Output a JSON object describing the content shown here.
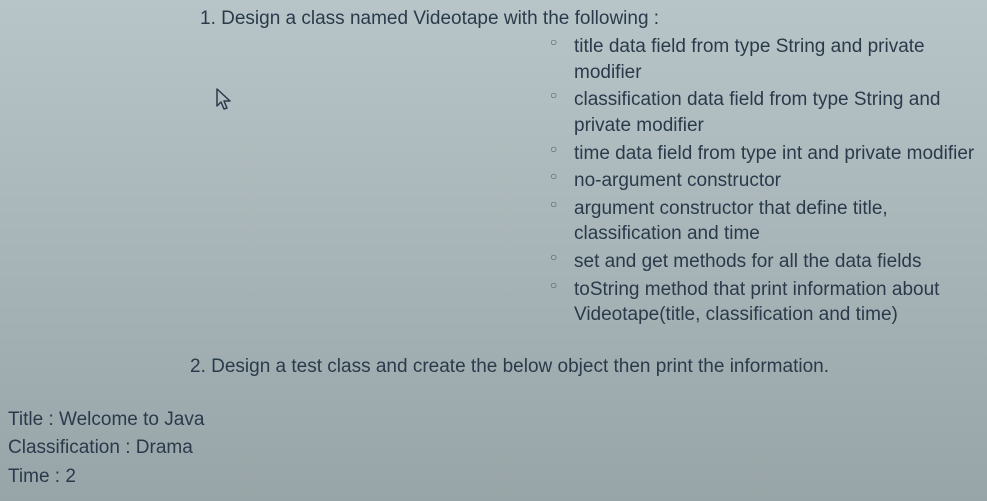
{
  "item1": {
    "heading": "1. Design a class named Videotape with the following :",
    "bullets": [
      "title data field from type String and private modifier",
      "classification data field from type String and private modifier",
      "time data field from type int and private modifier",
      "no-argument constructor",
      "argument constructor that define title, classification and time",
      "set and get methods for all the data fields",
      "toString method that print information about Videotape(title, classification and time)"
    ]
  },
  "item2": "2. Design a test class and create the below object then print the information.",
  "object": {
    "title_line": "Title : Welcome to Java",
    "classification_line": "Classification : Drama",
    "time_line": "Time : 2"
  }
}
